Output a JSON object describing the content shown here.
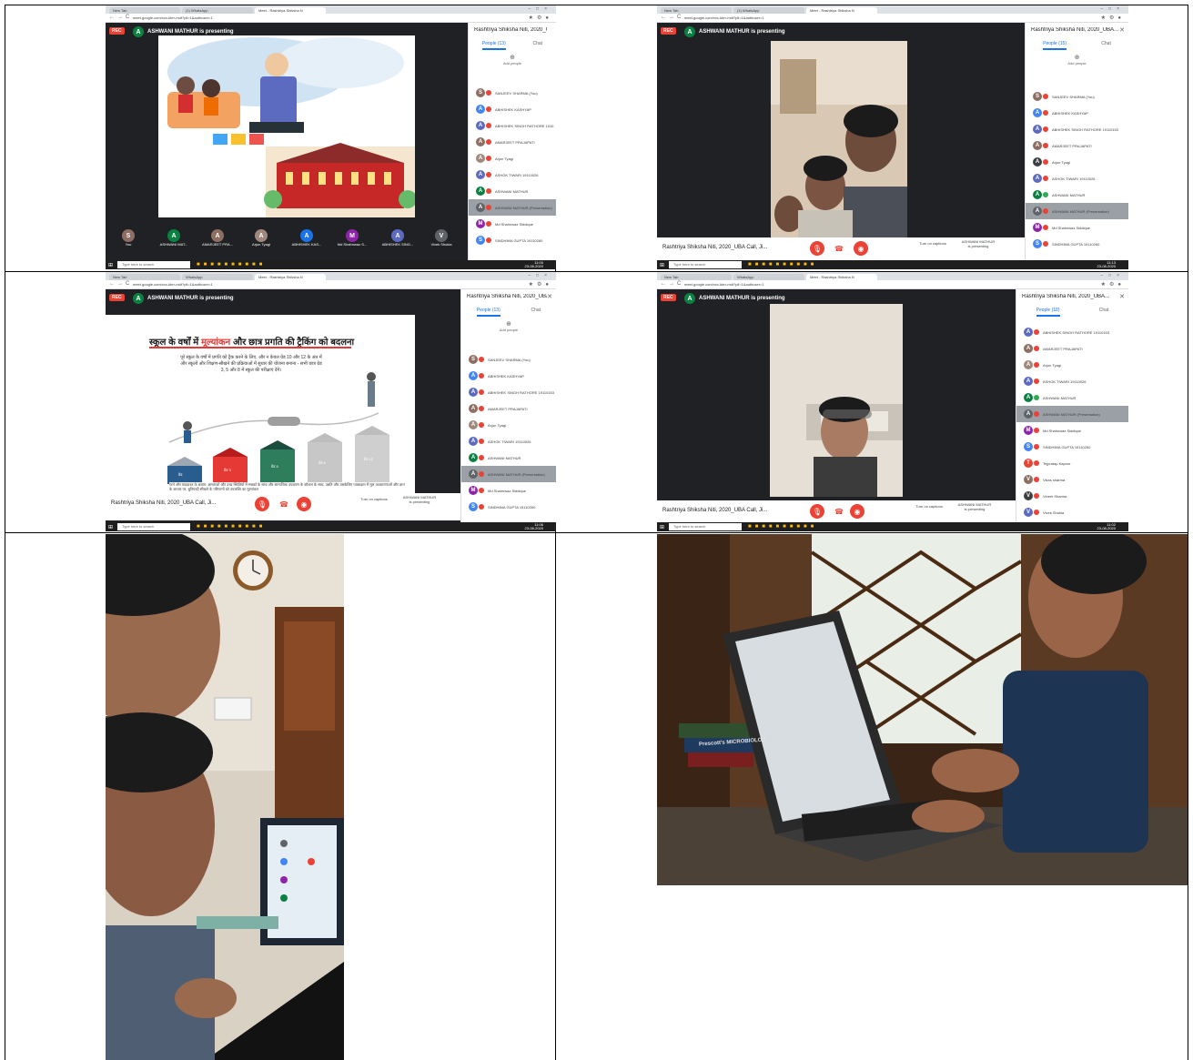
{
  "panel_1": {
    "tabs": [
      "New Tab",
      "(1) WhatsApp",
      "Meet - Rashtriya Shiksha N"
    ],
    "url": "meet.google.com/xxx-kbrr-mdt?pli=1&authuser=1",
    "rec_label": "REC",
    "presenter_initial": "A",
    "presenter_text": "ASHWANI MATHUR is presenting",
    "sidebar_title": "Rashtriya Shiksha Niti, 2020_UBA...",
    "people_tab": "People (13)",
    "chat_tab": "Chat",
    "add_people": "Add people",
    "participants": [
      {
        "initial": "S",
        "name": "SANJEEV SHARMA (You)",
        "color": "#8d6e63"
      },
      {
        "initial": "A",
        "name": "ABHISHEK KASHYAP",
        "color": "#4285f4"
      },
      {
        "initial": "A",
        "name": "ABHISHEK SINGH RATHORE 1910",
        "color": "#5c6bc0"
      },
      {
        "initial": "A",
        "name": "AMARJEET PRAJAPATI",
        "color": "#8d6e63"
      },
      {
        "initial": "A",
        "name": "Arjun Tyagi",
        "color": "#a1887f"
      },
      {
        "initial": "A",
        "name": "ASHOK TIWARI 19110026",
        "color": "#5c6bc0"
      },
      {
        "initial": "A",
        "name": "ASHWANI MATHUR",
        "color": "#0b8043"
      },
      {
        "initial": "A",
        "name": "ASHWANI MATHUR (Presentation)",
        "color": "#5f6368"
      },
      {
        "initial": "M",
        "name": "Md Shahnwaz Siddique",
        "color": "#8e24aa"
      },
      {
        "initial": "S",
        "name": "SINDHIMA GUPTA 19110260",
        "color": "#4285f4"
      }
    ],
    "tiles": [
      {
        "initial": "S",
        "name": "You",
        "color": "#8d6e63"
      },
      {
        "initial": "A",
        "name": "ASHWANI MAT...",
        "color": "#0b8043"
      },
      {
        "initial": "A",
        "name": "AMARJEET PRA...",
        "color": "#8d6e63"
      },
      {
        "initial": "A",
        "name": "Arjun Tyagi",
        "color": "#a1887f"
      },
      {
        "initial": "A",
        "name": "ABHISHEK KAS...",
        "color": "#1a73e8"
      },
      {
        "initial": "M",
        "name": "Md Shahnwaz S...",
        "color": "#8e24aa"
      },
      {
        "initial": "A",
        "name": "ABHISHEK SING...",
        "color": "#5c6bc0"
      },
      {
        "initial": "V",
        "name": "Vivek Shukla",
        "color": "#5f6368"
      }
    ],
    "taskbar_search": "Type here to search",
    "clock": "11:00\n23-08-2020"
  },
  "panel_2": {
    "tabs": [
      "New Tab",
      "(1) WhatsApp",
      "Meet - Rashtriya Shiksha N"
    ],
    "url": "meet.google.com/xxx-kbrr-mdt?pli=1&authuser=1",
    "rec_label": "REC",
    "presenter_initial": "A",
    "presenter_text": "ASHWANI MATHUR is presenting",
    "sidebar_title": "Rashtriya Shiksha Niti, 2020_UBA...",
    "people_tab": "People (15)",
    "chat_tab": "Chat",
    "add_people": "Add people",
    "participants": [
      {
        "initial": "S",
        "name": "SANJEEV SHARMA (You)",
        "color": "#8d6e63"
      },
      {
        "initial": "A",
        "name": "ABHISHEK KASHYAP",
        "color": "#4285f4"
      },
      {
        "initial": "A",
        "name": "ABHISHEK SINGH RATHORE 19110153",
        "color": "#5c6bc0"
      },
      {
        "initial": "A",
        "name": "AMARJEET PRAJAPATI",
        "color": "#8d6e63"
      },
      {
        "initial": "A",
        "name": "Arjun Tyagi",
        "color": "#3c4043"
      },
      {
        "initial": "A",
        "name": "ASHOK TIWARI 19110026",
        "color": "#5c6bc0"
      },
      {
        "initial": "A",
        "name": "ASHWANI MATHUR",
        "color": "#0b8043"
      },
      {
        "initial": "A",
        "name": "ASHWANI MATHUR (Presentation)",
        "color": "#5f6368"
      },
      {
        "initial": "M",
        "name": "Md Shahnwaz Siddique",
        "color": "#8e24aa"
      },
      {
        "initial": "S",
        "name": "SINDHIMA GUPTA 19110260",
        "color": "#4285f4"
      }
    ],
    "meeting_name": "Rashtriya Shiksha Niti, 2020_UBA Call, Ji...",
    "captions": "Turn on captions",
    "presenting": "ASHWANI MATHUR is presenting",
    "taskbar_search": "Type here to search",
    "clock": "11:13\n23-08-2020"
  },
  "panel_3": {
    "tabs": [
      "New Tab",
      "WhatsApp",
      "Meet - Rashtriya Shiksha N"
    ],
    "url": "meet.google.com/xxx-kbrr-mdt?pli=1&authuser=1",
    "rec_label": "REC",
    "presenter_initial": "A",
    "presenter_text": "ASHWANI MATHUR is presenting",
    "sidebar_title": "Rashtriya Shiksha Niti, 2020_UBA...",
    "people_tab": "People (13)",
    "chat_tab": "Chat",
    "add_people": "Add people",
    "slide_heading_a": "स्कूल के वर्षों में ",
    "slide_heading_red": "मूल्यांकन",
    "slide_heading_b": " और छात्र प्रगति की ट्रैकिंग को बदलना",
    "slide_text": "पूरे स्कूल के वर्षों में प्रगति को ट्रैक करने के लिए, और न केवल ग्रेड 10 और 12 के अंत में और स्कूलों और शिक्षण-सीखने की प्रक्रियाओं में सुधार की योजना बनाना - सभी छात्र ग्रेड 3, 5 और 8 में स्कूल की परीक्षाएं देंगे।",
    "bar_labels": [
      "ग्रेड",
      "ग्रेड 3",
      "ग्रेड 5",
      "ग्रेड 8",
      "ग्रेड 12"
    ],
    "slide_footer": "रटने और याददाश्त के बजाय: क्षमताओं और उच्च स्थितियों में सबको के साथ और सामाजिक उपकरण के कौशल के साथ, उन्नति और उसकेलिए पाठ्यक्रम में मूल अवधारणाओं और ज्ञान के आधार पर, बुनियादी सीखने के परिणामों को उपलब्धि का मूल्यांकन",
    "participants": [
      {
        "initial": "S",
        "name": "SANJEEV SHARMA (You)",
        "color": "#8d6e63"
      },
      {
        "initial": "A",
        "name": "ABHISHEK KASHYAP",
        "color": "#4285f4"
      },
      {
        "initial": "A",
        "name": "ABHISHEK SINGH RATHORE 19110153",
        "color": "#5c6bc0"
      },
      {
        "initial": "A",
        "name": "AMARJEET PRAJAPATI",
        "color": "#8d6e63"
      },
      {
        "initial": "A",
        "name": "Arjun Tyagi",
        "color": "#a1887f"
      },
      {
        "initial": "A",
        "name": "ASHOK TIWARI 19110026",
        "color": "#5c6bc0"
      },
      {
        "initial": "A",
        "name": "ASHWANI MATHUR",
        "color": "#0b8043"
      },
      {
        "initial": "A",
        "name": "ASHWANI MATHUR (Presentation)",
        "color": "#5f6368"
      },
      {
        "initial": "M",
        "name": "Md Shahnwaz Siddique",
        "color": "#8e24aa"
      },
      {
        "initial": "S",
        "name": "SINDHIMA GUPTA 19110260",
        "color": "#4285f4"
      }
    ],
    "meeting_name": "Rashtriya Shiksha Niti, 2020_UBA Call, Ji...",
    "captions": "Turn on captions",
    "presenting": "ASHWANI MATHUR is presenting",
    "taskbar_search": "Type here to search",
    "clock": "11:06\n23-08-2020"
  },
  "panel_4": {
    "tabs": [
      "New Tab",
      "WhatsApp",
      "Meet - Rashtriya Shiksha N"
    ],
    "url": "meet.google.com/xxx-kbrr-mdt?pli=1&authuser=1",
    "rec_label": "REC",
    "presenter_initial": "A",
    "presenter_text": "ASHWANI MATHUR is presenting",
    "sidebar_title": "Rashtriya Shiksha Niti, 2020_UBA...",
    "people_tab": "People (18)",
    "chat_tab": "Chat",
    "participants": [
      {
        "initial": "A",
        "name": "ABHISHEK SINGH RATHORE 19110153",
        "color": "#5c6bc0"
      },
      {
        "initial": "A",
        "name": "AMARJEET PRAJAPATI",
        "color": "#8d6e63"
      },
      {
        "initial": "A",
        "name": "Arjun Tyagi",
        "color": "#a1887f"
      },
      {
        "initial": "A",
        "name": "ASHOK TIWARI 19110026",
        "color": "#5c6bc0"
      },
      {
        "initial": "A",
        "name": "ASHWANI MATHUR",
        "color": "#0b8043"
      },
      {
        "initial": "A",
        "name": "ASHWANI MATHUR (Presentation)",
        "color": "#5f6368"
      },
      {
        "initial": "M",
        "name": "Md Shahnwaz Siddique",
        "color": "#8e24aa"
      },
      {
        "initial": "S",
        "name": "SINDHIMA GUPTA 19110260",
        "color": "#4285f4"
      },
      {
        "initial": "T",
        "name": "Tejpratap Kapoor",
        "color": "#ea4335"
      },
      {
        "initial": "V",
        "name": "Vikas sharma",
        "color": "#8d6e63"
      },
      {
        "initial": "V",
        "name": "Vineet Sharma",
        "color": "#3c4043"
      },
      {
        "initial": "V",
        "name": "Vivek Shukla",
        "color": "#5c6bc0"
      }
    ],
    "meeting_name": "Rashtriya Shiksha Niti, 2020_UBA Call, Ji...",
    "captions": "Turn on captions",
    "presenting": "ASHWANI MATHUR is presenting",
    "taskbar_search": "Type here to search",
    "clock": "11:02\n23-08-2020"
  },
  "photo_5": {
    "book_spine": ""
  },
  "photo_6": {
    "book_spine": "Prescott's MICROBIOLOG"
  },
  "colors": {
    "meet_dark": "#202124",
    "rec_red": "#ea4335",
    "accent_blue": "#1a73e8",
    "presenter_green": "#0b8043"
  }
}
